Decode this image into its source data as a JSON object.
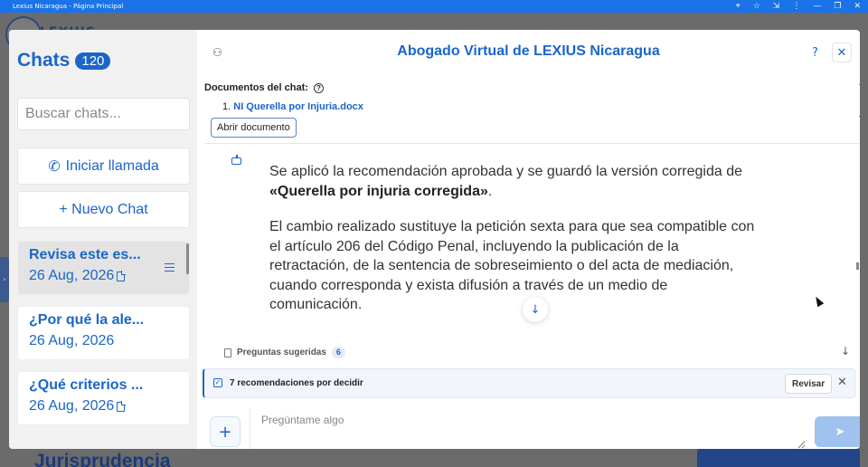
{
  "window": {
    "title": "Lexius Nicaragua - Página Principal",
    "controls": [
      "⌖",
      "☆",
      "⇲",
      "⋮",
      "—",
      "❐",
      "✕"
    ]
  },
  "background": {
    "logo_text": "LEXIUS",
    "footer_text": "Jurisprudencia"
  },
  "sidebar": {
    "title": "Chats",
    "count": "120",
    "search_placeholder": "Buscar chats...",
    "call_icon": "phone-icon",
    "call_label": "Iniciar llamada",
    "new_chat_label": "+ Nuevo Chat",
    "chats": [
      {
        "title": "Revisa este es...",
        "date": "26 Aug, 2026",
        "has_doc": true,
        "active": true
      },
      {
        "title": "¿Por qué la ale...",
        "date": "26 Aug, 2026",
        "has_doc": false,
        "active": false
      },
      {
        "title": "¿Qué criterios ...",
        "date": "26 Aug, 2026",
        "has_doc": true,
        "active": false
      }
    ]
  },
  "header": {
    "title": "Abogado Virtual de LEXIUS Nicaragua",
    "help": "?",
    "close": "✕"
  },
  "documents": {
    "label": "Documentos del chat:",
    "items": [
      {
        "index": "1.",
        "name": "NI Querella por Injuria.docx"
      }
    ],
    "open_label": "Abrir documento"
  },
  "message": {
    "p1_before": "Se aplicó la recomendación aprobada y se guardó la versión corregida de ",
    "p1_bold": "«Querella por injuria corregida»",
    "p1_after": ".",
    "p2": "El cambio realizado sustituye la petición sexta para que sea compatible con el artículo 206 del Código Penal, incluyendo la publicación de la retractación, de la sentencia de sobreseimiento o del acta de mediación, cuando corresponda y exista difusión a través de un medio de comunicación."
  },
  "suggested": {
    "label": "Preguntas sugeridas",
    "count": "6"
  },
  "recommendations": {
    "text": "7 recomendaciones por decidir",
    "review_label": "Revisar"
  },
  "composer": {
    "placeholder": "Pregúntame algo"
  },
  "colors": {
    "accent": "#1b65c9",
    "send": "#9fc2ee",
    "titlebar": "#1a73e8"
  }
}
